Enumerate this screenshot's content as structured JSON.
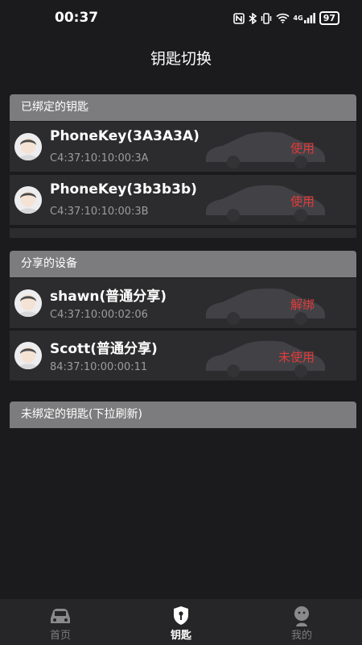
{
  "status_bar": {
    "time": "00:37",
    "icons": [
      "nfc-icon",
      "bluetooth-icon",
      "vibrate-icon",
      "wifi-icon",
      "signal-icon"
    ],
    "signal_label": "4G",
    "battery": "97"
  },
  "page_title": "钥匙切换",
  "bound_keys": {
    "header": "已绑定的钥匙",
    "items": [
      {
        "name": "PhoneKey(3A3A3A)",
        "mac": "C4:37:10:10:00:3A",
        "action": "使用"
      },
      {
        "name": "PhoneKey(3b3b3b)",
        "mac": "C4:37:10:10:00:3B",
        "action": "使用"
      }
    ]
  },
  "shared_devices": {
    "header": "分享的设备",
    "items": [
      {
        "name": "shawn(普通分享)",
        "mac": "C4:37:10:00:02:06",
        "action": "解绑"
      },
      {
        "name": "Scott(普通分享)",
        "mac": "84:37:10:00:00:11",
        "action": "未使用"
      }
    ]
  },
  "unbound_keys": {
    "header": "未绑定的钥匙(下拉刷新)"
  },
  "tabbar": {
    "tabs": [
      {
        "label": "首页",
        "icon": "car-icon",
        "active": false
      },
      {
        "label": "钥匙",
        "icon": "key-shield-icon",
        "active": true
      },
      {
        "label": "我的",
        "icon": "profile-icon",
        "active": false
      }
    ]
  },
  "colors": {
    "background": "#1b1b1d",
    "row_background": "#2c2c2e",
    "section_header": "#7c7c7e",
    "action_red": "#e23b3b",
    "tab_inactive": "#7c7c7e"
  }
}
